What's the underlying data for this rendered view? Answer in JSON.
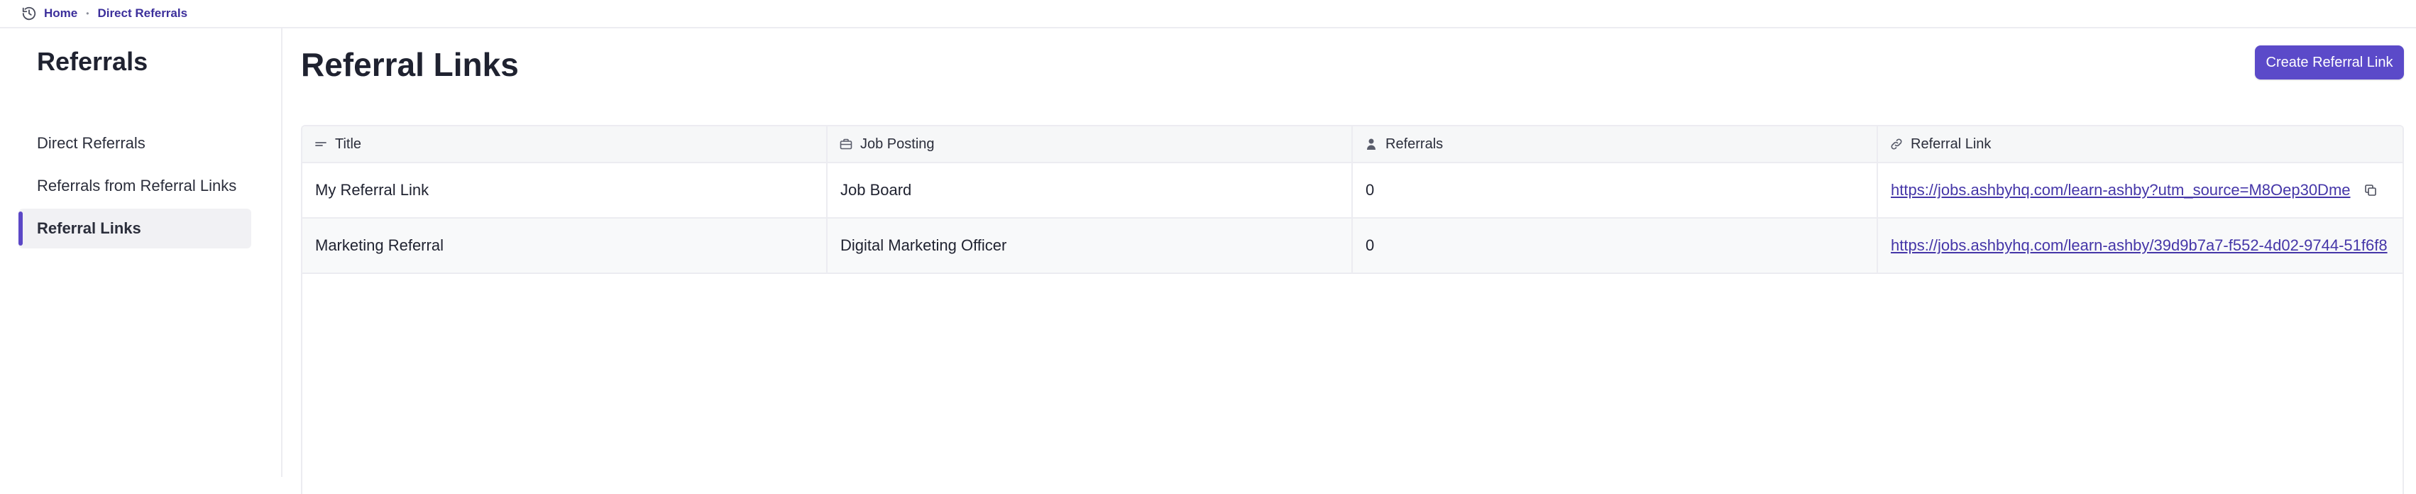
{
  "breadcrumb": {
    "icon": "history-icon",
    "items": [
      {
        "label": "Home"
      },
      {
        "label": "Direct Referrals"
      }
    ],
    "separator": "•"
  },
  "sidebar": {
    "title": "Referrals",
    "items": [
      {
        "label": "Direct Referrals",
        "active": false
      },
      {
        "label": "Referrals from Referral Links",
        "active": false
      },
      {
        "label": "Referral Links",
        "active": true
      }
    ]
  },
  "main": {
    "title": "Referral Links",
    "create_button": "Create Referral Link"
  },
  "table": {
    "columns": [
      {
        "label": "Title",
        "icon": "text-lines-icon"
      },
      {
        "label": "Job Posting",
        "icon": "briefcase-icon"
      },
      {
        "label": "Referrals",
        "icon": "person-icon"
      },
      {
        "label": "Referral Link",
        "icon": "link-icon"
      }
    ],
    "rows": [
      {
        "title": "My Referral Link",
        "job_posting": "Job Board",
        "referrals": "0",
        "link": "https://jobs.ashbyhq.com/learn-ashby?utm_source=M8Oep30Dme"
      },
      {
        "title": "Marketing Referral",
        "job_posting": "Digital Marketing Officer",
        "referrals": "0",
        "link": "https://jobs.ashbyhq.com/learn-ashby/39d9b7a7-f552-4d02-9744-51f6f8"
      }
    ]
  },
  "colors": {
    "accent": "#5b4ac9",
    "link": "#4536a8",
    "border": "#ececf1"
  }
}
